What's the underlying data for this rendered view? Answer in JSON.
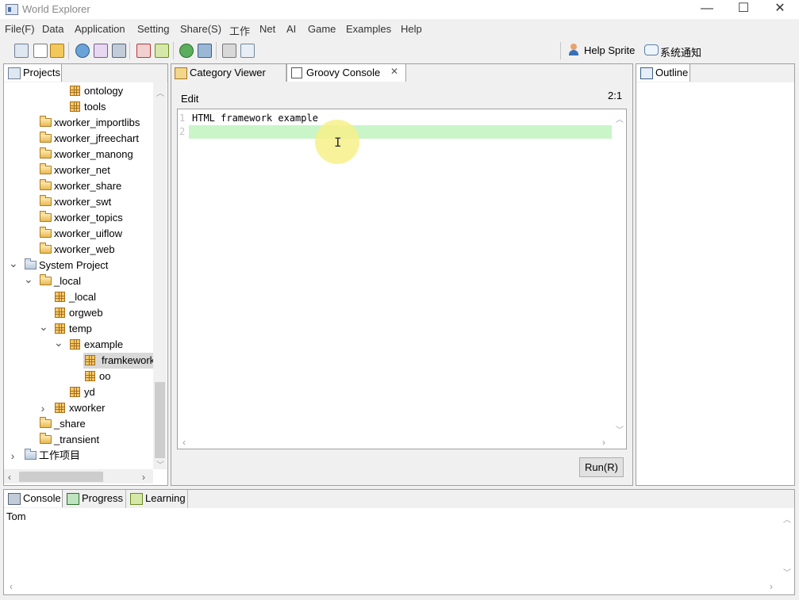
{
  "window": {
    "title": "World Explorer",
    "minimize": "—",
    "maximize": "☐",
    "close": "✕"
  },
  "menu": [
    "File(F)",
    "Data",
    "Application",
    "Setting",
    "Share(S)",
    "工作",
    "Net",
    "AI",
    "Game",
    "Examples",
    "Help"
  ],
  "toolbar_right": {
    "help_sprite": "Help Sprite",
    "system_notice": "系统通知"
  },
  "projects": {
    "tab_label": "Projects",
    "tree": [
      {
        "label": "ontology",
        "icon": "package-icon",
        "indent": 4,
        "arrow": ""
      },
      {
        "label": "tools",
        "icon": "package-icon",
        "indent": 4,
        "arrow": ""
      },
      {
        "label": "xworker_importlibs",
        "icon": "folder-icon",
        "indent": 2,
        "arrow": ""
      },
      {
        "label": "xworker_jfreechart",
        "icon": "folder-icon",
        "indent": 2,
        "arrow": ""
      },
      {
        "label": "xworker_manong",
        "icon": "folder-icon",
        "indent": 2,
        "arrow": ""
      },
      {
        "label": "xworker_net",
        "icon": "folder-icon",
        "indent": 2,
        "arrow": ""
      },
      {
        "label": "xworker_share",
        "icon": "folder-icon",
        "indent": 2,
        "arrow": ""
      },
      {
        "label": "xworker_swt",
        "icon": "folder-icon",
        "indent": 2,
        "arrow": ""
      },
      {
        "label": "xworker_topics",
        "icon": "folder-icon",
        "indent": 2,
        "arrow": ""
      },
      {
        "label": "xworker_uiflow",
        "icon": "folder-icon",
        "indent": 2,
        "arrow": ""
      },
      {
        "label": "xworker_web",
        "icon": "folder-icon",
        "indent": 2,
        "arrow": ""
      },
      {
        "label": "System Project",
        "icon": "system-folder-icon",
        "indent": 1,
        "arrow": "down"
      },
      {
        "label": "_local",
        "icon": "folder-icon",
        "indent": 2,
        "arrow": "down"
      },
      {
        "label": "_local",
        "icon": "package-icon",
        "indent": 3,
        "arrow": ""
      },
      {
        "label": "orgweb",
        "icon": "package-icon",
        "indent": 3,
        "arrow": ""
      },
      {
        "label": "temp",
        "icon": "package-icon",
        "indent": 3,
        "arrow": "down"
      },
      {
        "label": "example",
        "icon": "package-icon",
        "indent": 4,
        "arrow": "down"
      },
      {
        "label": "framkework",
        "icon": "package-icon",
        "indent": 5,
        "arrow": "",
        "selected": true
      },
      {
        "label": "oo",
        "icon": "package-icon",
        "indent": 5,
        "arrow": ""
      },
      {
        "label": "yd",
        "icon": "package-icon",
        "indent": 4,
        "arrow": ""
      },
      {
        "label": "xworker",
        "icon": "package-icon",
        "indent": 3,
        "arrow": "right"
      },
      {
        "label": "_share",
        "icon": "folder-icon",
        "indent": 2,
        "arrow": ""
      },
      {
        "label": "_transient",
        "icon": "folder-icon",
        "indent": 2,
        "arrow": ""
      },
      {
        "label": "工作项目",
        "icon": "system-folder-icon",
        "indent": 1,
        "arrow": "right"
      }
    ]
  },
  "editor": {
    "tabs": [
      {
        "label": "Category Viewer",
        "active": false
      },
      {
        "label": "Groovy Console",
        "active": true
      }
    ],
    "edit_label": "Edit",
    "cursor_pos": "2:1",
    "lines": [
      {
        "num": "1",
        "text": "HTML framework example"
      },
      {
        "num": "2",
        "text": ""
      }
    ],
    "run_button": "Run(R)"
  },
  "outline": {
    "tab_label": "Outline"
  },
  "bottom": {
    "tabs": [
      "Console",
      "Progress",
      "Learning"
    ],
    "console_text": "Tom"
  },
  "colors": {
    "highlight_line": "#c9f5c9",
    "cursor_halo": "#f7f08a",
    "selection": "#d9d9d9"
  }
}
